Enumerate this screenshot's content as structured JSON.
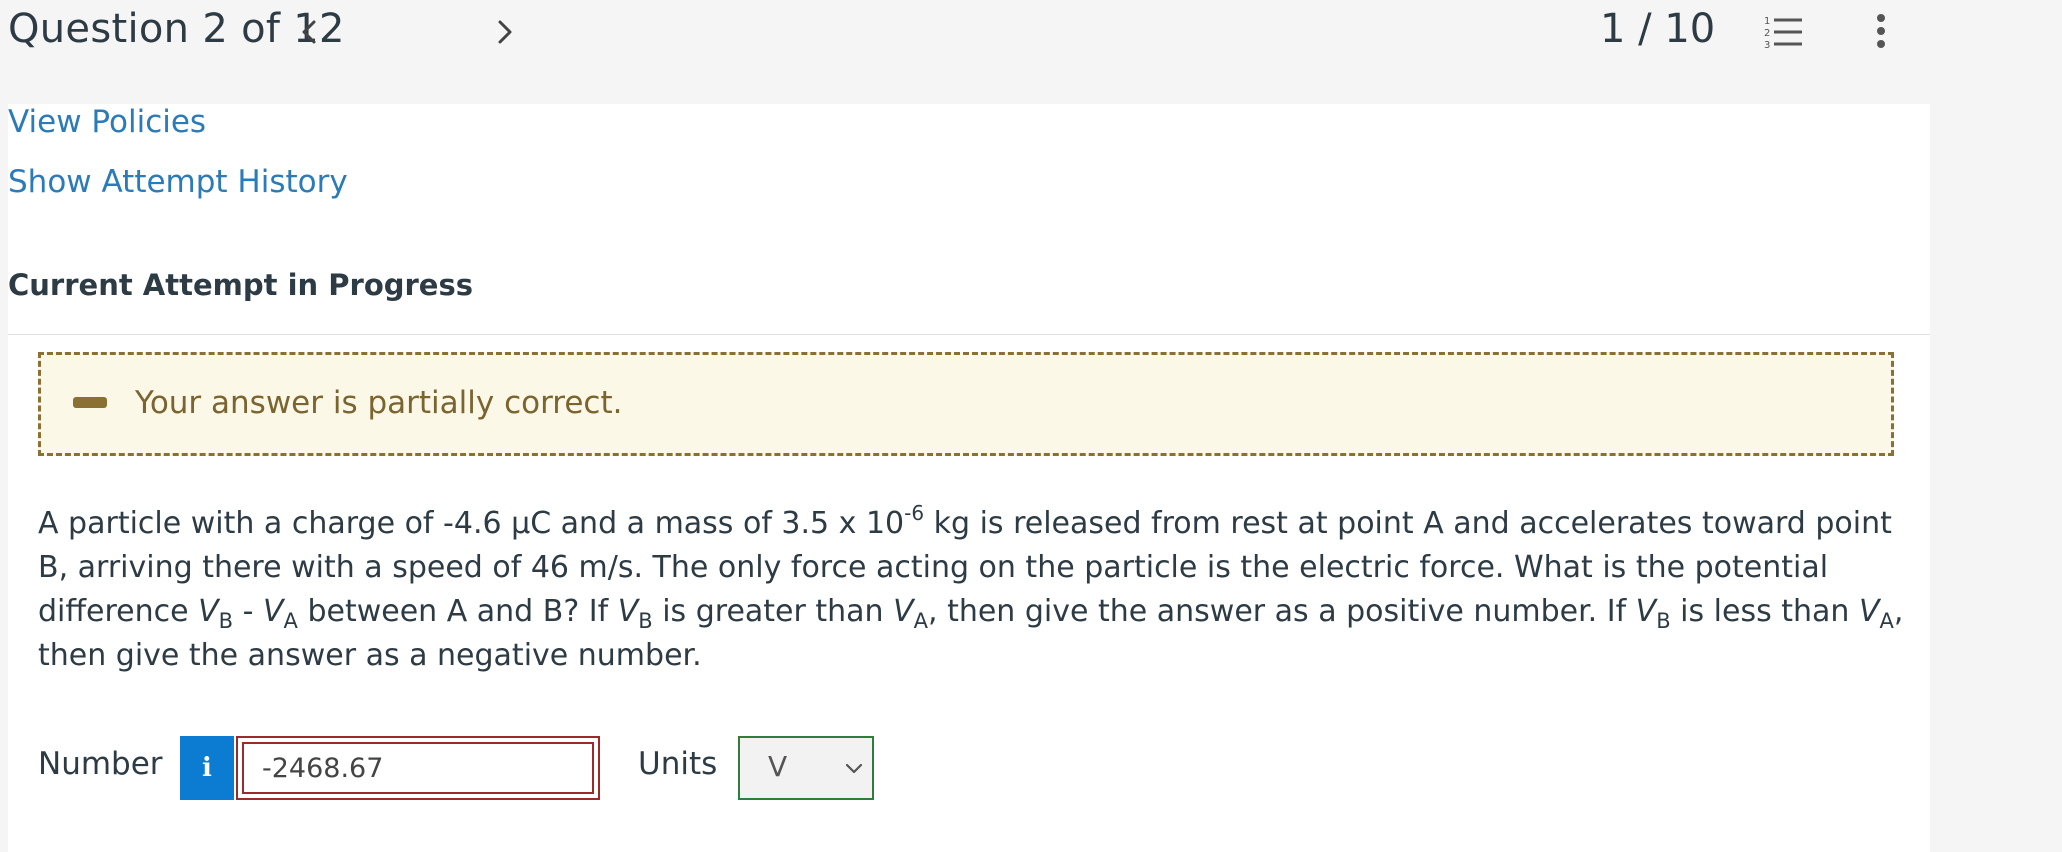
{
  "header": {
    "question_title": "Question 2 of 12",
    "counter": "1 / 10",
    "prev_icon": "chevron-left-icon",
    "next_icon": "chevron-right-icon",
    "list_icon": "numbered-list-icon",
    "more_icon": "vertical-ellipsis-icon"
  },
  "links": {
    "view_policies": "View Policies",
    "show_attempt_history": "Show Attempt History"
  },
  "attempt": {
    "heading": "Current Attempt in Progress"
  },
  "feedback": {
    "icon": "partial-dash-icon",
    "message": "Your answer is partially correct.",
    "color": "#8a7133",
    "background": "#fcf8e8"
  },
  "question": {
    "p1": "A particle with a charge of -4.6 μC and a mass of 3.5 x 10",
    "exp": "-6",
    "p2": " kg is released from rest at point A and accelerates toward point B, arriving there with a speed of 46 m/s. The only force acting on the particle is the electric force. What is the potential difference ",
    "v": "V",
    "b": "B",
    "a": "A",
    "dash": " - ",
    "p3": " between A and B? If ",
    "gt": " is greater than ",
    "then_pos": ", then give the answer as a positive number. If ",
    "lt": " is less than ",
    "then_neg": ", then give the answer as a negative number."
  },
  "answer": {
    "number_label": "Number",
    "info_label": "i",
    "value": "-2468.67",
    "units_label": "Units",
    "units_value": "V",
    "input_border_color": "#9b2a2a",
    "select_border_color": "#2f7d3b"
  }
}
